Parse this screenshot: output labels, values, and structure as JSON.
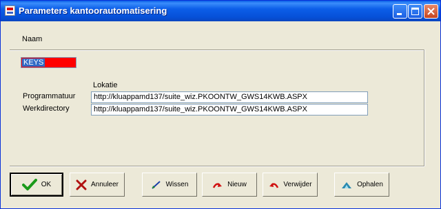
{
  "window": {
    "title": "Parameters kantoorautomatisering"
  },
  "labels": {
    "naam": "Naam",
    "lokatie": "Lokatie",
    "programmatuur": "Programmatuur",
    "werkdirectory": "Werkdirectory"
  },
  "keys_field": {
    "value": "KEYS"
  },
  "fields": {
    "programmatuur": "http://kluappamd137/suite_wiz.PKOONTW_GWS14KWB.ASPX",
    "werkdirectory": "http://kluappamd137/suite_wiz.PKOONTW_GWS14KWB.ASPX"
  },
  "buttons": {
    "ok": "OK",
    "annuleer": "Annuleer",
    "wissen": "Wissen",
    "nieuw": "Nieuw",
    "verwijder": "Verwijder",
    "ophalen": "Ophalen"
  },
  "colors": {
    "titlebar": "#0a5fe6",
    "keys_background": "#ff0000",
    "selection": "#316ac5",
    "window_face": "#ece9d8"
  },
  "icons": [
    "app-icon",
    "minimize-icon",
    "maximize-icon",
    "close-icon",
    "checkmark-icon",
    "x-icon",
    "eraser-icon",
    "new-arrow-icon",
    "delete-arrow-icon",
    "fetch-icon"
  ]
}
